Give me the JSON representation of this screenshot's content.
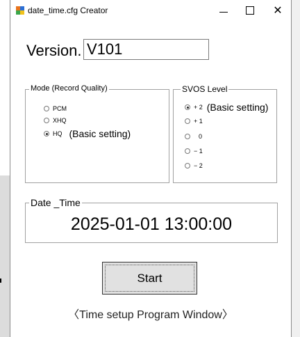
{
  "window": {
    "title": "date_time.cfg Creator",
    "controls": {
      "minimize": "—",
      "maximize": "☐",
      "close": "✕"
    },
    "icon": "app-icon"
  },
  "version": {
    "label": "Version.",
    "value": "V101"
  },
  "mode_group": {
    "legend": "Mode (Record Quality)",
    "options": [
      {
        "label": "PCM",
        "selected": false
      },
      {
        "label": "XHQ",
        "selected": false
      },
      {
        "label": "HQ",
        "selected": true,
        "note": "(Basic setting)"
      }
    ]
  },
  "svos_group": {
    "legend": "SVOS Level",
    "options": [
      {
        "label": "+ 2",
        "selected": true,
        "note": "(Basic setting)"
      },
      {
        "label": "+ 1",
        "selected": false
      },
      {
        "label": "0",
        "selected": false
      },
      {
        "label": "− 1",
        "selected": false
      },
      {
        "label": "− 2",
        "selected": false
      }
    ]
  },
  "datetime": {
    "legend": "Date _Time",
    "value": "2025-01-01 13:00:00"
  },
  "start_button": {
    "label": "Start"
  },
  "caption": "〈Time setup Program Window〉",
  "colors": {
    "icon_orange": "#e8741c",
    "icon_blue": "#2a6fd6",
    "icon_green": "#3aa64a",
    "icon_yellow": "#f2c21b",
    "button_bg": "#e1e1e1"
  }
}
